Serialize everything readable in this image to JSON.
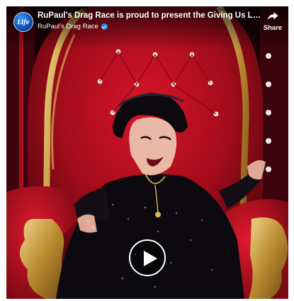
{
  "video": {
    "title": "RuPaul's Drag Race is proud to present the Giving Us Life…",
    "channel_name": "RuPaul's Drag Race",
    "avatar_text": "Life",
    "share_label": "Share"
  },
  "colors": {
    "throne_red": "#c5121f",
    "gold": "#c8a04a",
    "verified_blue": "#1d8cf0"
  },
  "icons": [
    "verified-badge-icon",
    "share-arrow-icon",
    "play-icon"
  ]
}
